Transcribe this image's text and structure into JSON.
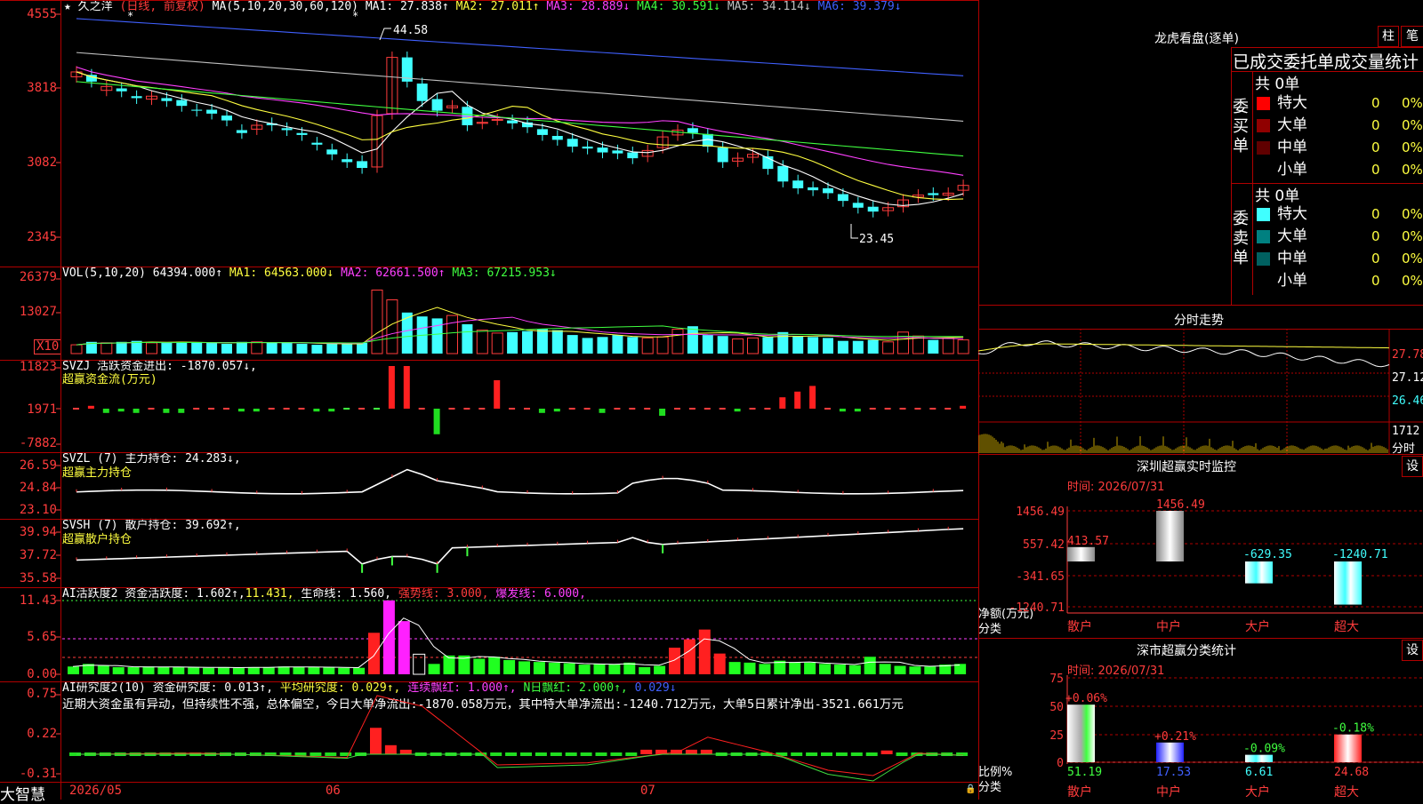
{
  "main": {
    "stock_name": "久之洋",
    "period_label": "(日线, 前复权)",
    "ma_title": "MA(5,10,20,30,60,120)",
    "ma_values": [
      {
        "label": "MA1: 27.838↑",
        "color": "#ffffff"
      },
      {
        "label": "MA2: 27.011↑",
        "color": "#ffff40"
      },
      {
        "label": "MA3: 28.889↓",
        "color": "#ff40ff"
      },
      {
        "label": "MA4: 30.591↓",
        "color": "#40ff40"
      },
      {
        "label": "MA5: 34.114↓",
        "color": "#c0c0c0"
      },
      {
        "label": "MA6: 39.379↓",
        "color": "#4060ff"
      }
    ],
    "y_ticks": [
      "4555",
      "3818",
      "3082",
      "2345"
    ],
    "high_label": "44.58",
    "low_label": "23.45"
  },
  "vol": {
    "title": "VOL(5,10,20)",
    "value": "64394.000↑",
    "ma1": "MA1: 64563.000↓",
    "ma2": "MA2: 62661.500↑",
    "ma3": "MA3: 67215.953↓",
    "y_ticks": [
      "26379",
      "13027"
    ],
    "unit": "X10"
  },
  "svzj": {
    "title": "SVZJ  活跃资金进出: -1870.057↓,",
    "subtitle": "超赢资金流(万元)",
    "y_ticks": [
      "11823",
      "1971",
      "-7882"
    ]
  },
  "svzl": {
    "title": "SVZL (7) 主力持仓: 24.283↓,",
    "subtitle": "超赢主力持仓",
    "y_ticks": [
      "26.59",
      "24.84",
      "23.10"
    ]
  },
  "svsh": {
    "title": "SVSH (7) 散户持仓: 39.692↑,",
    "subtitle": "超赢散户持仓",
    "y_ticks": [
      "39.94",
      "37.72",
      "35.58"
    ]
  },
  "ai1": {
    "title": "AI活跃度2",
    "v1": "资金活跃度: 1.602↑,",
    "v2": "11.431,",
    "v3": "生命线: 1.560,",
    "v4": "强势线: 3.000,",
    "v5": "爆发线: 6.000,",
    "y_ticks": [
      "11.43",
      "5.65",
      "0.00"
    ]
  },
  "ai2": {
    "title": "AI研究度2(10)",
    "v1": "资金研究度: 0.013↑,",
    "v2": "平均研究度: 0.029↑,",
    "v3": "连续飘红: 1.000↑,",
    "v4": "N日飘红: 2.000↑,",
    "v5": "0.029↓",
    "comment": "近期大资金虽有异动，但持续性不强，总体偏空，今日大单净流出:-1870.058万元，其中特大单净流出:-1240.712万元，大单5日累计净出-3521.661万元",
    "y_ticks": [
      "0.75",
      "0.22",
      "-0.31"
    ]
  },
  "xaxis": {
    "brand": "大智慧",
    "dates": [
      "2026/05",
      "06",
      "07"
    ]
  },
  "dragon": {
    "title": "龙虎看盘(逐单)",
    "btn1": "柱",
    "btn2": "笔",
    "header": "已成交委托单成交量统计",
    "buy_label": "委买单",
    "sell_label": "委卖单",
    "buy_total": "共 0单",
    "sell_total": "共 0单",
    "buy_rows": [
      {
        "name": "特大",
        "count": "0",
        "pct": "0%",
        "color": "#ff0000"
      },
      {
        "name": "大单",
        "count": "0",
        "pct": "0%",
        "color": "#900000"
      },
      {
        "name": "中单",
        "count": "0",
        "pct": "0%",
        "color": "#600000"
      },
      {
        "name": "小单",
        "count": "0",
        "pct": "0%",
        "color": ""
      }
    ],
    "sell_rows": [
      {
        "name": "特大",
        "count": "0",
        "pct": "0%",
        "color": "#40ffff"
      },
      {
        "name": "大单",
        "count": "0",
        "pct": "0%",
        "color": "#008080"
      },
      {
        "name": "中单",
        "count": "0",
        "pct": "0%",
        "color": "#006060"
      },
      {
        "name": "小单",
        "count": "0",
        "pct": "0%",
        "color": ""
      }
    ]
  },
  "intraday": {
    "title": "分时走势",
    "y_ticks": [
      "27.78",
      "27.12",
      "26.46"
    ],
    "vol_tick": "1712",
    "vol_label": "分时"
  },
  "monitor": {
    "title": "深圳超赢实时监控",
    "btn": "设",
    "time": "时间: 2026/07/31",
    "y_ticks": [
      "1456.49",
      "557.42",
      "-341.65",
      "-1240.71"
    ],
    "ylabel": "净额(万元)",
    "xlabel": "分类",
    "categories": [
      "散户",
      "中户",
      "大户",
      "超大"
    ],
    "values": [
      413.57,
      1456.49,
      -629.35,
      -1240.71
    ],
    "value_labels": [
      "413.57",
      "1456.49",
      "-629.35",
      "-1240.71"
    ]
  },
  "stats": {
    "title": "深市超赢分类统计",
    "btn": "设",
    "time": "时间: 2026/07/31",
    "y_ticks": [
      "75",
      "50",
      "25",
      "0"
    ],
    "ylabel": "比例%",
    "xlabel": "分类",
    "categories": [
      "散户",
      "中户",
      "大户",
      "超大"
    ],
    "values": [
      51.19,
      17.53,
      6.61,
      24.68
    ],
    "value_labels": [
      "51.19",
      "17.53",
      "6.61",
      "24.68"
    ],
    "change_labels": [
      "+0.06%",
      "+0.21%",
      "-0.09%",
      "-0.18%"
    ]
  }
}
